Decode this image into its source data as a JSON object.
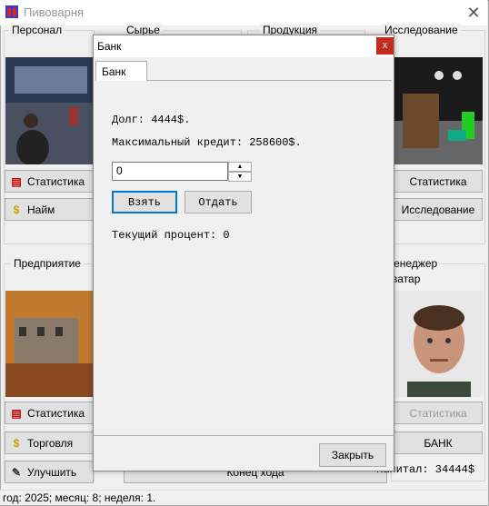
{
  "window": {
    "title": "Пивоварня"
  },
  "groups": {
    "personnel": "Персонал",
    "raw": "Сырье",
    "products": "Продукция",
    "research": "Исследование",
    "enterprise": "Предприятие",
    "manager": "Менеджер",
    "avatar": "Аватар"
  },
  "buttons": {
    "stats1": "Статистика",
    "hire": "Найм",
    "stats2": "Статистика",
    "trade": "Торговля",
    "upgrade": "Улучшить",
    "stats_right": "Статистика",
    "research": "Исследование",
    "stats_right2": "Статистика",
    "bank": "БАНК",
    "end_turn": "Конец хода"
  },
  "capital": "Капитал: 34444$",
  "status": "год: 2025; месяц: 8; неделя: 1.",
  "dialog": {
    "title": "Банк",
    "close": "x",
    "tab": "Банк",
    "debt": "Долг: 4444$.",
    "max_credit": "Максимальный кредит: 258600$.",
    "amount": "0",
    "take": "Взять",
    "give": "Отдать",
    "rate": "Текущий процент: 0",
    "close_button": "Закрыть"
  }
}
